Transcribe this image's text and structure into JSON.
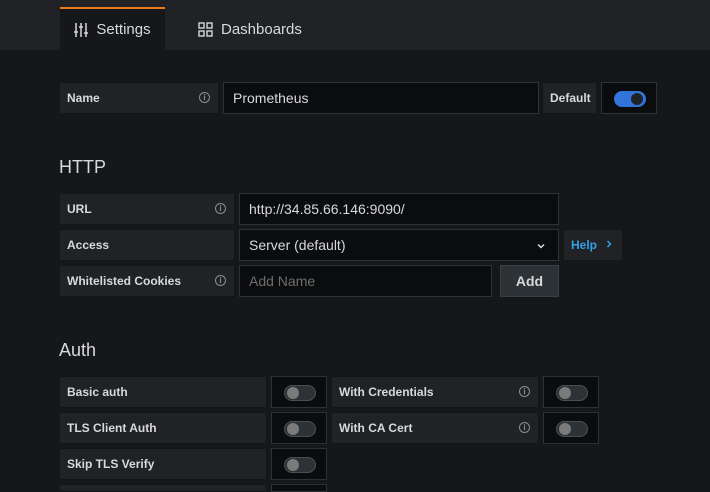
{
  "tabs": [
    {
      "label": "Settings",
      "icon": "sliders-icon",
      "active": true
    },
    {
      "label": "Dashboards",
      "icon": "grid-icon",
      "active": false
    }
  ],
  "name_row": {
    "label": "Name",
    "value": "Prometheus",
    "default_label": "Default",
    "default_on": true
  },
  "http": {
    "title": "HTTP",
    "url_label": "URL",
    "url_value": "http://34.85.66.146:9090/",
    "access_label": "Access",
    "access_value": "Server (default)",
    "help_label": "Help",
    "cookies_label": "Whitelisted Cookies",
    "cookies_placeholder": "Add Name",
    "add_label": "Add"
  },
  "auth": {
    "title": "Auth",
    "basic_auth": "Basic auth",
    "with_credentials": "With Credentials",
    "tls_client_auth": "TLS Client Auth",
    "with_ca_cert": "With CA Cert",
    "skip_tls_verify": "Skip TLS Verify"
  },
  "colors": {
    "accent": "#eb7b18",
    "toggle_on": "#3274d9",
    "link": "#33a2e5"
  }
}
